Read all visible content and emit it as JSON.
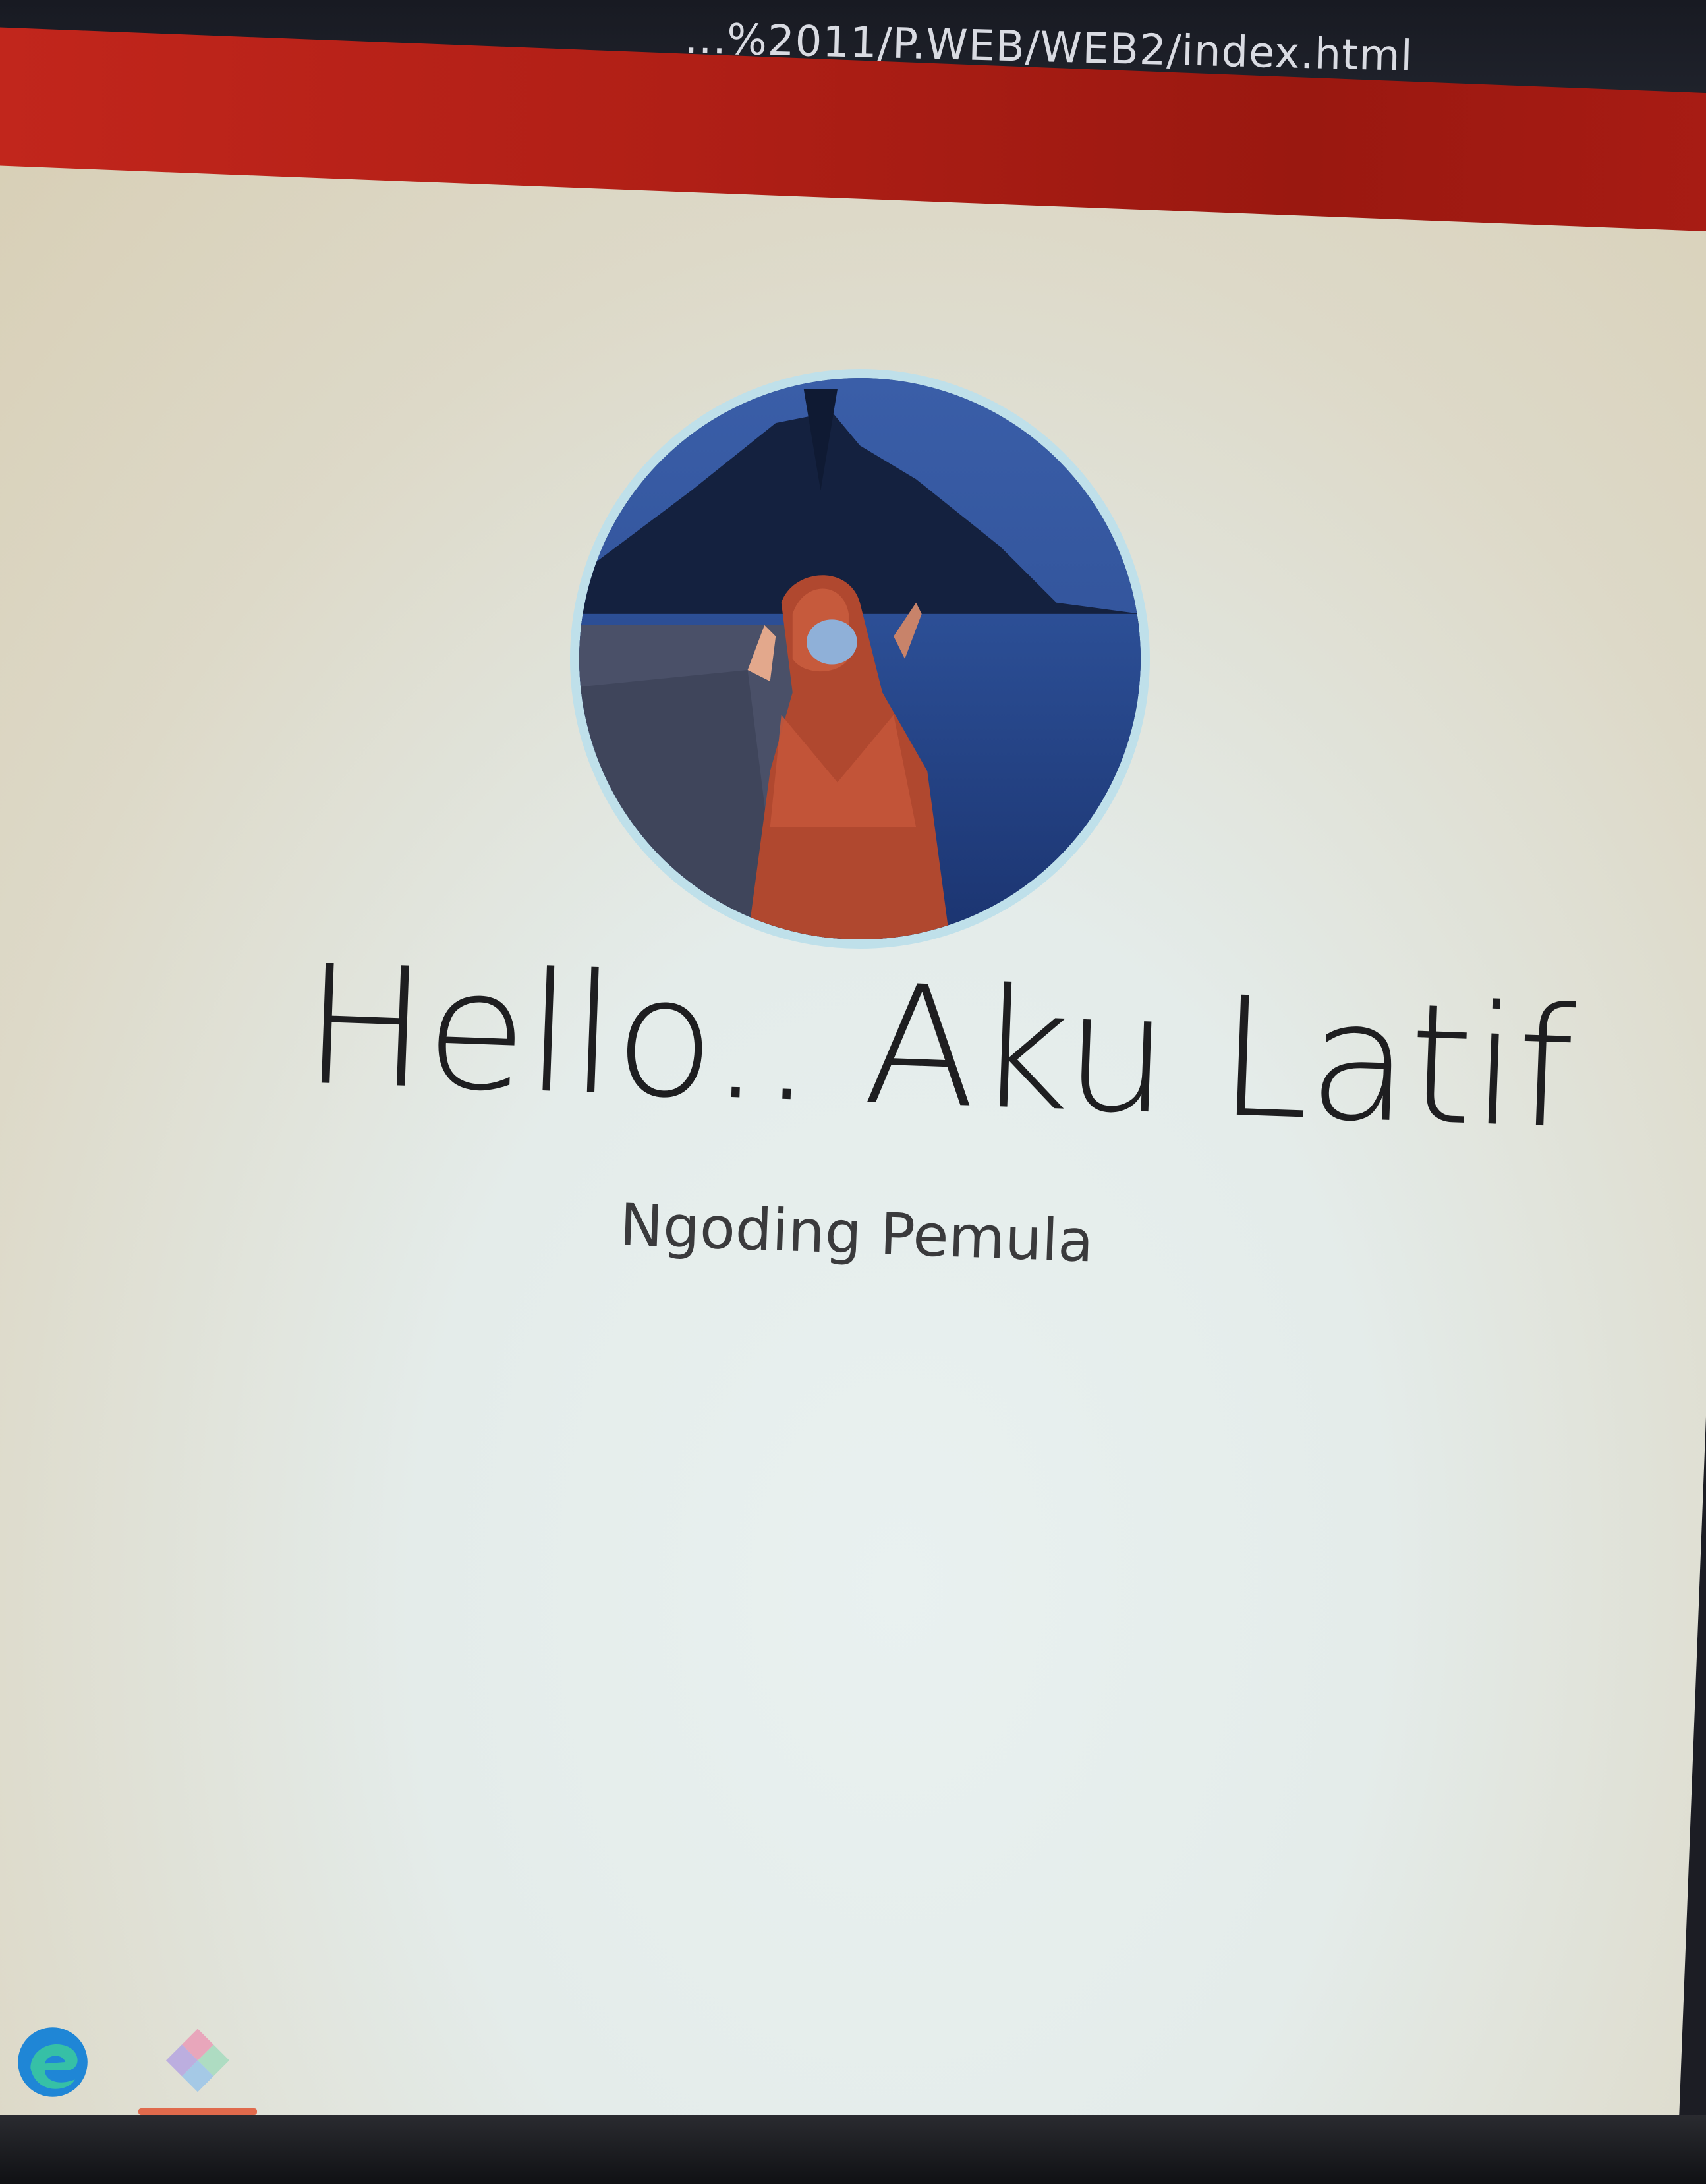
{
  "browser": {
    "address": "...%2011/P.WEB/WEB2/index.html"
  },
  "profile": {
    "avatar_alt": "profile photo",
    "heading": "Hello.. Aku Latif",
    "subheading": "Ngoding Pemula"
  },
  "colors": {
    "navbar": "#b01f16",
    "avatar_border": "#bfe0ea",
    "heading_text": "#1e1e20"
  },
  "taskbar": {
    "icons": [
      "edge-browser-icon",
      "app-icon"
    ]
  }
}
